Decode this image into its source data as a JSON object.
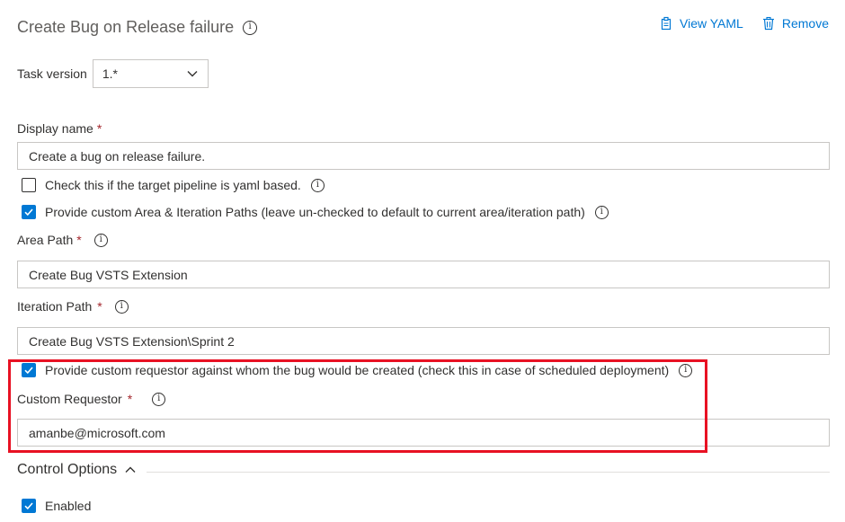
{
  "header": {
    "title": "Create Bug on Release failure",
    "view_yaml": "View YAML",
    "remove": "Remove"
  },
  "task_version": {
    "label": "Task version",
    "value": "1.*"
  },
  "display_name": {
    "label": "Display name",
    "required_mark": "*",
    "value": "Create a bug on release failure."
  },
  "checks": {
    "yaml_based": {
      "label": "Check this if the target pipeline is yaml based.",
      "checked": false
    },
    "custom_paths": {
      "label": "Provide custom Area & Iteration Paths (leave un-checked to default to current area/iteration path)",
      "checked": true
    },
    "custom_requestor": {
      "label": "Provide custom requestor against whom the bug would be created (check this in case of scheduled deployment)",
      "checked": true
    },
    "enabled": {
      "label": "Enabled",
      "checked": true
    }
  },
  "area_path": {
    "label": "Area Path",
    "required_mark": "*",
    "value": "Create Bug VSTS Extension"
  },
  "iteration_path": {
    "label": "Iteration Path",
    "required_mark": "*",
    "value": "Create Bug VSTS Extension\\Sprint 2"
  },
  "custom_requestor": {
    "label": "Custom Requestor",
    "required_mark": "*",
    "value": "amanbe@microsoft.com"
  },
  "control_options": {
    "label": "Control Options"
  },
  "colors": {
    "accent": "#0078d4",
    "highlight": "#e81123",
    "required": "#a4262c"
  }
}
